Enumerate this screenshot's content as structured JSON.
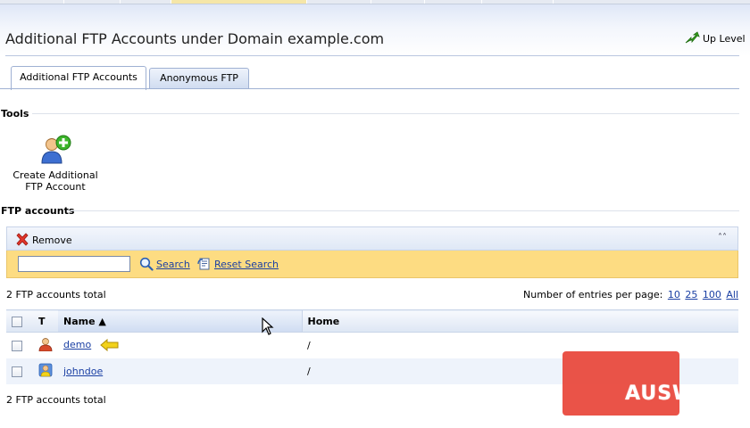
{
  "header": {
    "title": "Additional FTP Accounts under Domain example.com",
    "up_level": "Up Level"
  },
  "tabs": [
    {
      "label": "Additional FTP Accounts",
      "active": true
    },
    {
      "label": "Anonymous FTP",
      "active": false
    }
  ],
  "tools": {
    "section_title": "Tools",
    "create_label": "Create Additional FTP Account"
  },
  "ftp": {
    "section_title": "FTP accounts",
    "remove_label": "Remove",
    "search_value": "",
    "search_label": "Search",
    "reset_label": "Reset Search",
    "total_top": "2 FTP accounts total",
    "total_bottom": "2 FTP accounts total",
    "per_page_label": "Number of entries per page:",
    "per_page_options": [
      "10",
      "25",
      "100",
      "All"
    ],
    "columns": {
      "type": "T",
      "name": "Name",
      "home": "Home"
    },
    "rows": [
      {
        "name": "demo",
        "home": "/"
      },
      {
        "name": "johndoe",
        "home": "/"
      }
    ]
  },
  "watermark": {
    "text": "AUSWEB"
  },
  "colors": {
    "search_bar": "#fddc82",
    "link": "#1a3fa3",
    "watermark": "#e8463a"
  }
}
